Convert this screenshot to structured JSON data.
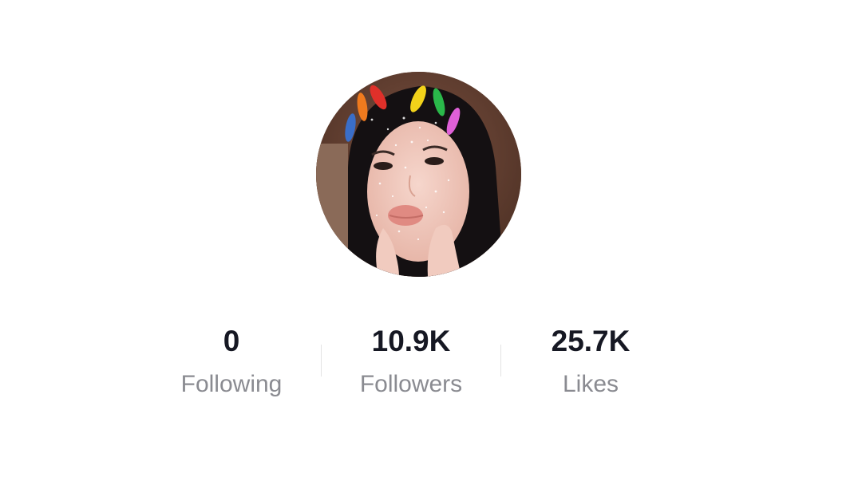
{
  "profile": {
    "avatar": "avatar-photo",
    "stats": {
      "following": {
        "count": "0",
        "label": "Following"
      },
      "followers": {
        "count": "10.9K",
        "label": "Followers"
      },
      "likes": {
        "count": "25.7K",
        "label": "Likes"
      }
    }
  },
  "colors": {
    "count_text": "#161823",
    "label_text": "#8a8b91",
    "divider": "#e3e3e4",
    "background": "#ffffff"
  }
}
